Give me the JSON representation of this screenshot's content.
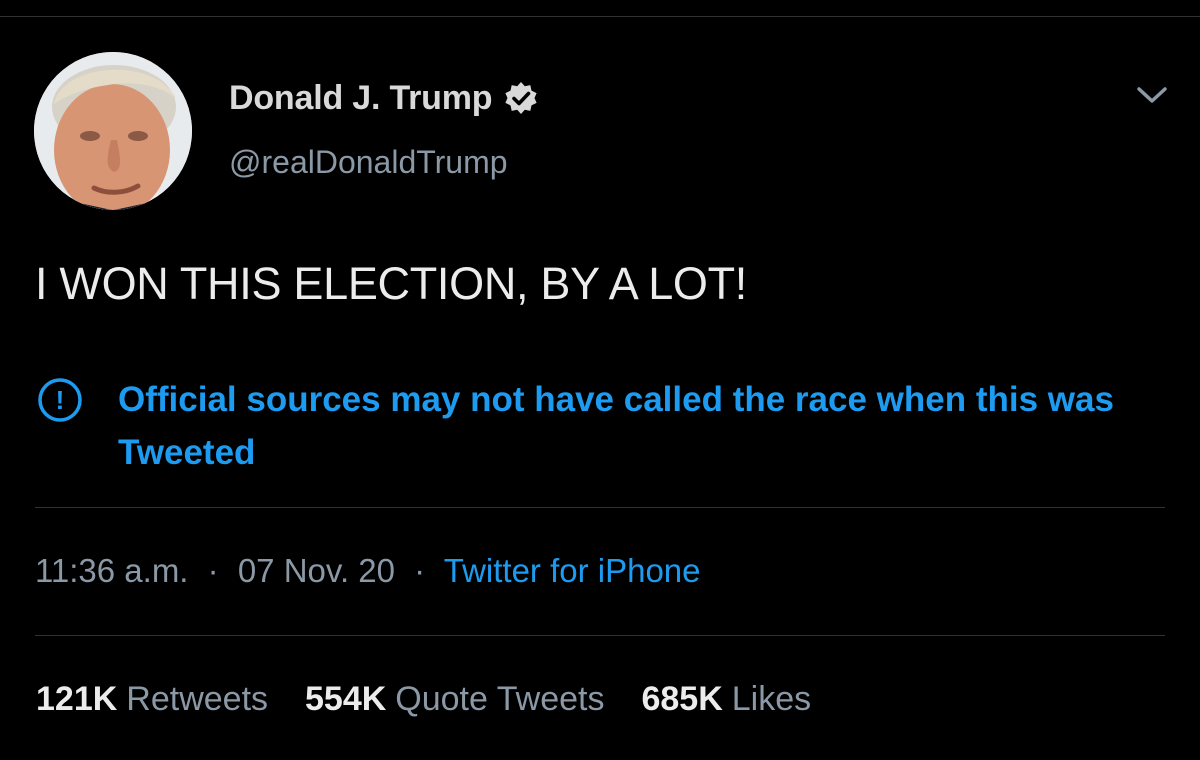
{
  "author": {
    "display_name": "Donald J. Trump",
    "handle": "@realDonaldTrump",
    "verified": true
  },
  "icons": {
    "avatar": "profile-photo",
    "verified": "verified-badge-icon",
    "menu": "chevron-down-icon",
    "notice": "exclamation-circle-icon"
  },
  "tweet": {
    "text": "I WON THIS ELECTION, BY A LOT!"
  },
  "notice": {
    "text": "Official sources may not have called the race when this was Tweeted"
  },
  "meta": {
    "time": "11:36 a.m.",
    "date": "07 Nov. 20",
    "separator": "·",
    "source": "Twitter for iPhone"
  },
  "stats": [
    {
      "count": "121K",
      "label": "Retweets"
    },
    {
      "count": "554K",
      "label": "Quote Tweets"
    },
    {
      "count": "685K",
      "label": "Likes"
    }
  ],
  "colors": {
    "background": "#000000",
    "text": "#d9d9d9",
    "secondary": "#8b98a5",
    "accent": "#1d9bf0",
    "divider": "#2f3336"
  }
}
